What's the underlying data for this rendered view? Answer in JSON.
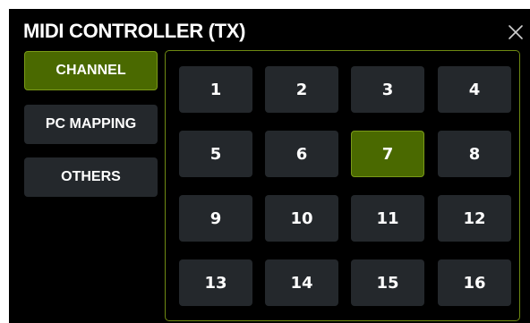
{
  "dialog": {
    "title": "MIDI CONTROLLER (TX)"
  },
  "sidebar": {
    "items": [
      {
        "label": "CHANNEL",
        "active": true
      },
      {
        "label": "PC MAPPING",
        "active": false
      },
      {
        "label": "OTHERS",
        "active": false
      }
    ]
  },
  "channels": {
    "selected": "7",
    "cells": [
      "1",
      "2",
      "3",
      "4",
      "5",
      "6",
      "7",
      "8",
      "9",
      "10",
      "11",
      "12",
      "13",
      "14",
      "15",
      "16"
    ]
  },
  "icons": {
    "close": "close-icon"
  },
  "colors": {
    "background": "#000000",
    "button": "#24282c",
    "accent": "#4a6900",
    "accent_border": "#7a9a17",
    "panel_border": "#6f8a12",
    "text": "#ffffff"
  }
}
